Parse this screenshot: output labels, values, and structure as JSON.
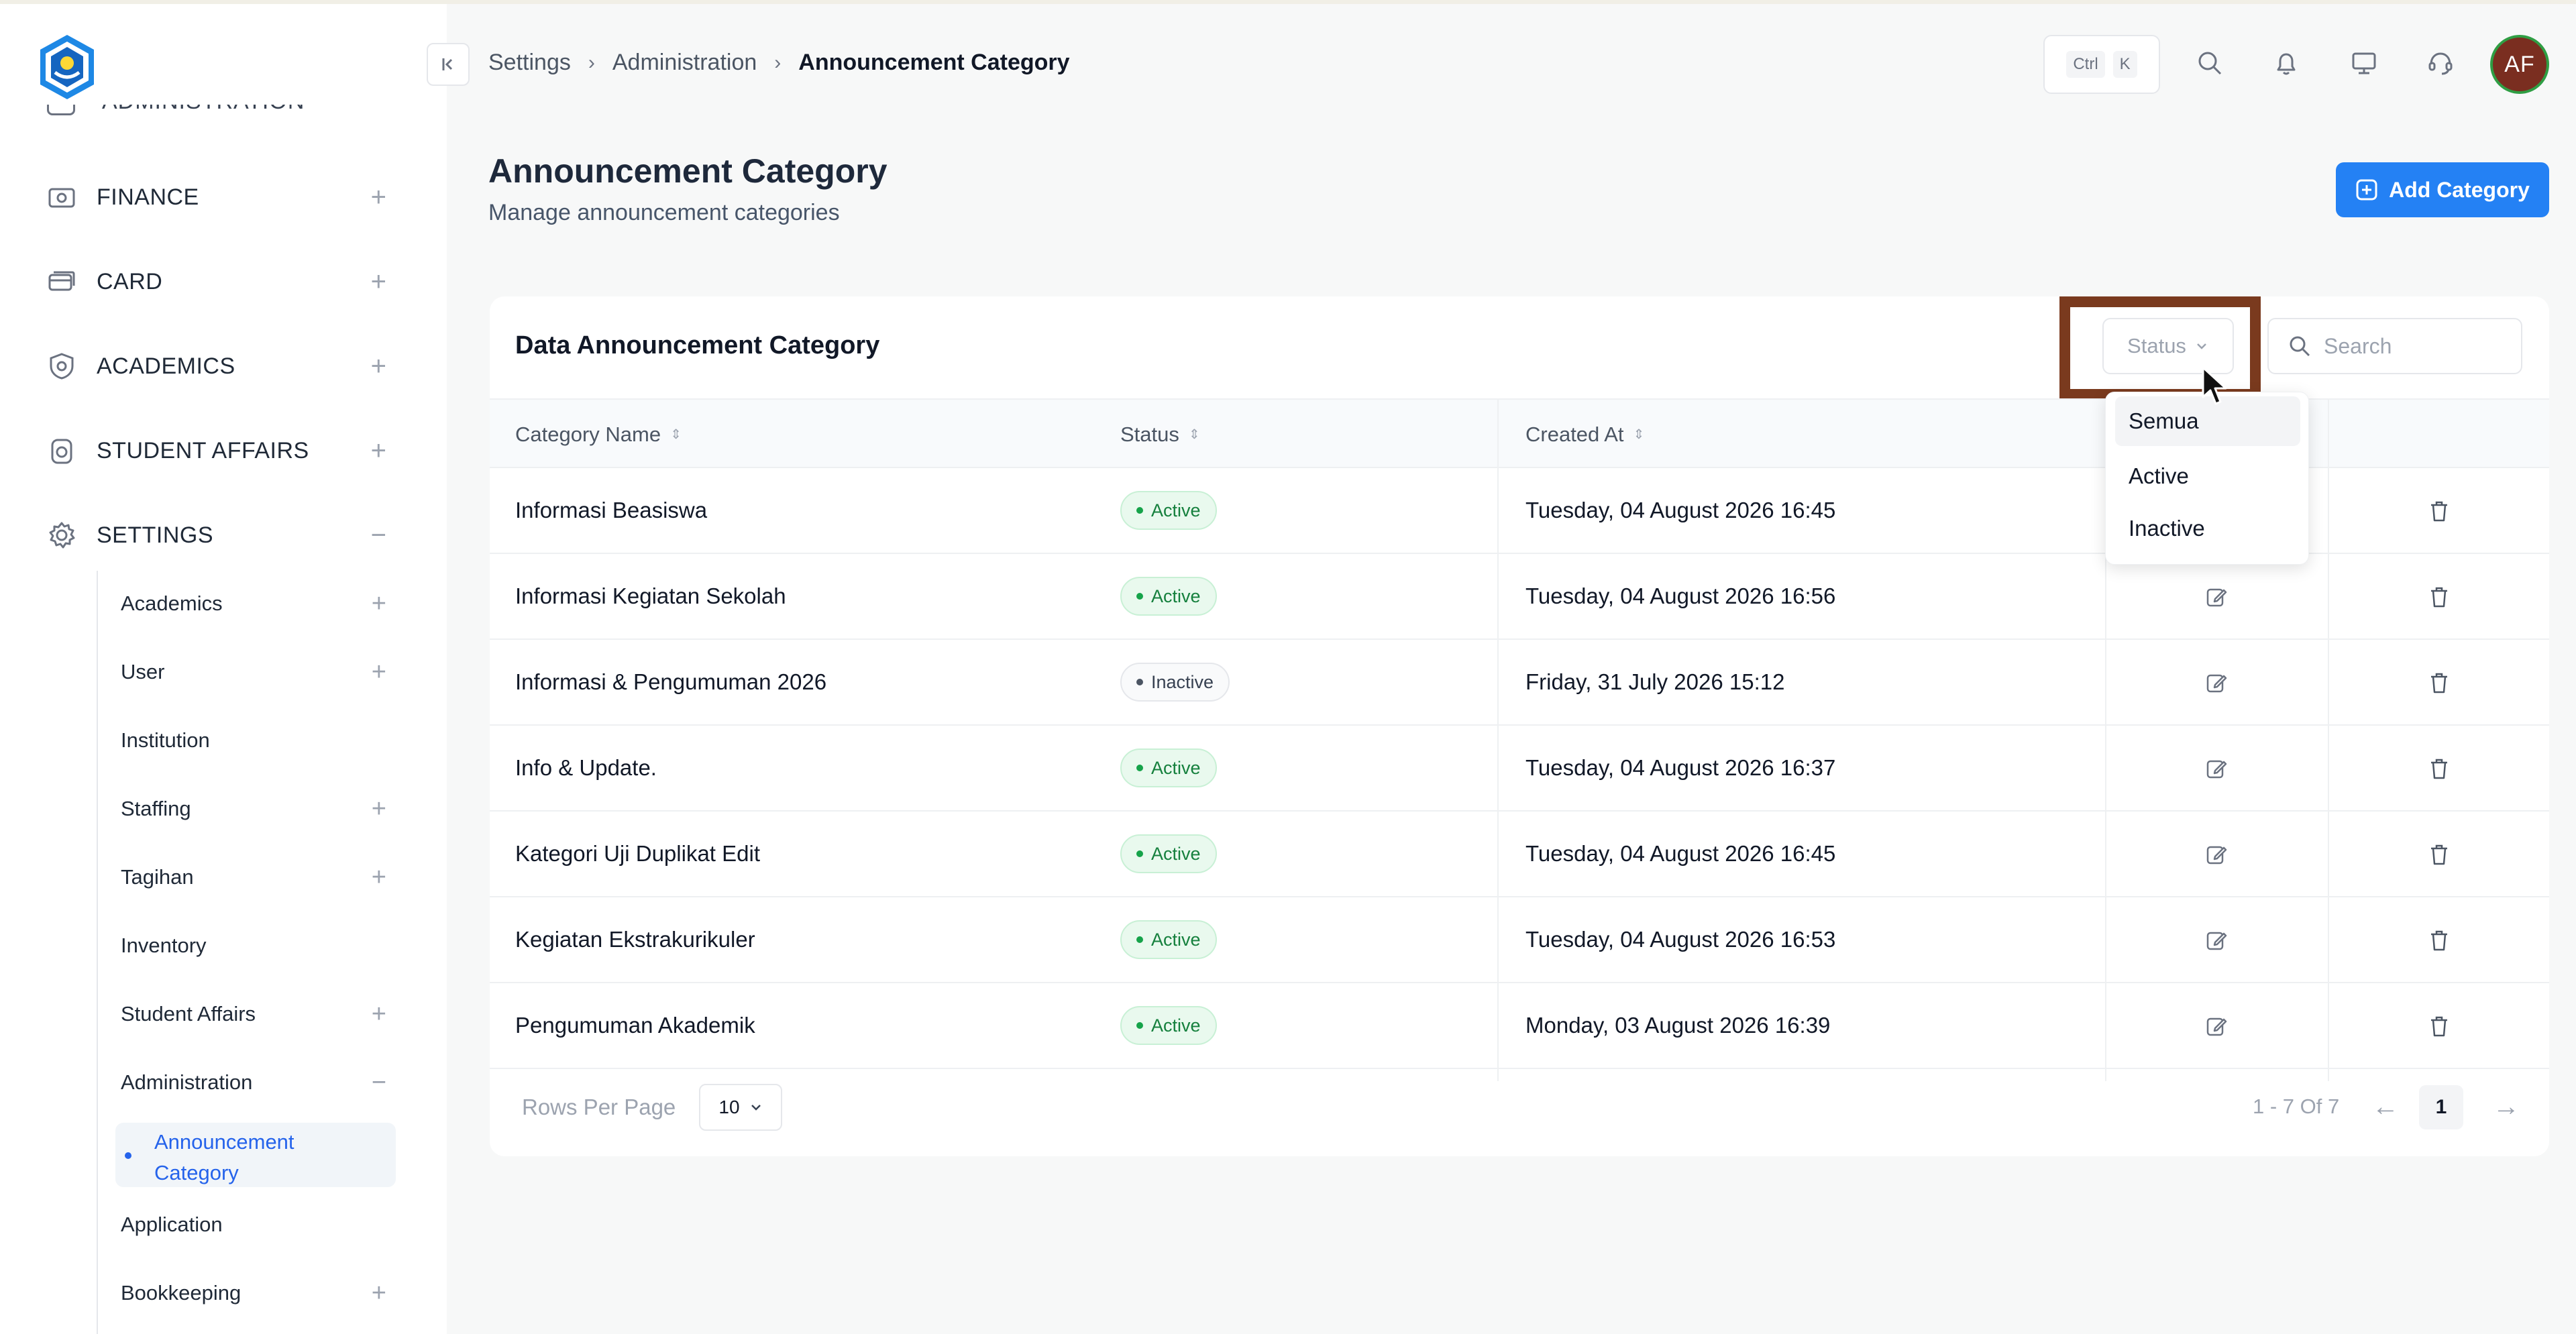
{
  "sidebar": {
    "cut_item": "ADMINISTRATION",
    "items": [
      {
        "label": "FINANCE",
        "toggle": "+",
        "icon": "finance-icon"
      },
      {
        "label": "CARD",
        "toggle": "+",
        "icon": "card-icon"
      },
      {
        "label": "ACADEMICS",
        "toggle": "+",
        "icon": "academics-icon"
      },
      {
        "label": "STUDENT AFFAIRS",
        "toggle": "+",
        "icon": "student-affairs-icon"
      },
      {
        "label": "SETTINGS",
        "toggle": "−",
        "icon": "gear-icon"
      }
    ],
    "sub_items": [
      {
        "label": "Academics",
        "toggle": "+"
      },
      {
        "label": "User",
        "toggle": "+"
      },
      {
        "label": "Institution",
        "toggle": ""
      },
      {
        "label": "Staffing",
        "toggle": "+"
      },
      {
        "label": "Tagihan",
        "toggle": "+"
      },
      {
        "label": "Inventory",
        "toggle": ""
      },
      {
        "label": "Student Affairs",
        "toggle": "+"
      },
      {
        "label": "Administration",
        "toggle": "−"
      }
    ],
    "active_sub": "Announcement Category",
    "after_items": [
      {
        "label": "Application",
        "toggle": ""
      },
      {
        "label": "Bookkeeping",
        "toggle": "+"
      }
    ]
  },
  "header": {
    "breadcrumb": [
      "Settings",
      "Administration",
      "Announcement Category"
    ],
    "shortcut": [
      "Ctrl",
      "K"
    ],
    "avatar_initials": "AF"
  },
  "page": {
    "title": "Announcement Category",
    "subtitle": "Manage announcement categories",
    "add_button": "Add Category"
  },
  "card": {
    "title": "Data Announcement Category",
    "status_filter": "Status",
    "search_placeholder": "Search",
    "columns": [
      "Category Name",
      "Status",
      "Created At"
    ],
    "rows": [
      {
        "name": "Informasi Beasiswa",
        "status": "Active",
        "created": "Tuesday, 04 August 2026 16:45"
      },
      {
        "name": "Informasi Kegiatan Sekolah",
        "status": "Active",
        "created": "Tuesday, 04 August 2026 16:56"
      },
      {
        "name": "Informasi & Pengumuman 2026",
        "status": "Inactive",
        "created": "Friday, 31 July 2026 15:12"
      },
      {
        "name": "Info & Update.",
        "status": "Active",
        "created": "Tuesday, 04 August 2026 16:37"
      },
      {
        "name": "Kategori Uji Duplikat Edit",
        "status": "Active",
        "created": "Tuesday, 04 August 2026 16:45"
      },
      {
        "name": "Kegiatan Ekstrakurikuler",
        "status": "Active",
        "created": "Tuesday, 04 August 2026 16:53"
      },
      {
        "name": "Pengumuman Akademik",
        "status": "Active",
        "created": "Monday, 03 August 2026 16:39"
      }
    ],
    "dropdown_options": [
      "Semua",
      "Active",
      "Inactive"
    ],
    "rows_per_page_label": "Rows Per Page",
    "rows_per_page": "10",
    "range": "1 - 7 Of 7",
    "current_page": "1",
    "prev_arrow": "←",
    "next_arrow": "→"
  },
  "colors": {
    "primary": "#2481f4",
    "active_badge": "#15803d",
    "highlight": "#7a3a1e",
    "avatar": "#7a2e20"
  }
}
